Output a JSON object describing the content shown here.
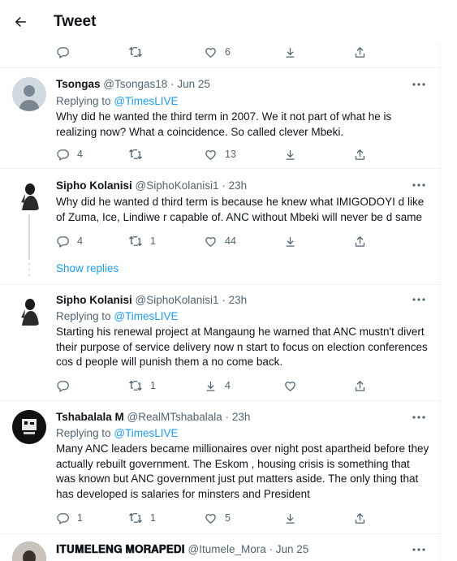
{
  "header": {
    "title": "Tweet"
  },
  "top_actions": {
    "likes": "6"
  },
  "tweets": [
    {
      "name": "Tsongas",
      "handle": "@Tsongas18",
      "sep": "·",
      "time": "Jun 25",
      "replying_prefix": "Replying to",
      "replying_to": "@TimesLIVE",
      "text": "Why did he wanted the third term in 2007. We it not part of what he is realizing now? What a coincidence. So called clever Mbeki.",
      "replies": "4",
      "retweets": "",
      "likes": "13"
    },
    {
      "name": "Sipho Kolanisi",
      "handle": "@SiphoKolanisi1",
      "sep": "·",
      "time": "23h",
      "text": "Why did he wanted d third term is because he knew what IMIGODOYI d like of Zuma, Ice, Lindiwe r capable of. ANC without Mbeki will never be d same",
      "replies": "4",
      "retweets": "1",
      "likes": "44"
    },
    {
      "name": "Sipho Kolanisi",
      "handle": "@SiphoKolanisi1",
      "sep": "·",
      "time": "23h",
      "replying_prefix": "Replying to",
      "replying_to": "@TimesLIVE",
      "text": "Starting his renewal project at Mangaung he warned that ANC mustn't divert their purpose of service delivery now n start to focus on election conferences cos d people will punish them a no come back.",
      "replies": "",
      "retweets": "1",
      "likes": "4"
    },
    {
      "name": "Tshabalala M",
      "handle": "@RealMTshabalala",
      "sep": "·",
      "time": "23h",
      "replying_prefix": "Replying to",
      "replying_to": "@TimesLIVE",
      "text": "Many ANC leaders became millionaires over night post apartheid before they actually rebuilt government. The Eskom , housing crisis is something that was known but ANC government just put matters aside. The only thing that has developed is salaries for minsters and President",
      "replies": "1",
      "retweets": "1",
      "likes": "5"
    },
    {
      "name": "𝐈𝐓𝐔𝐌𝐄𝐋𝐄𝐍𝐆 𝐌𝐎𝐑𝐀𝐏𝐄𝐃𝐈",
      "handle": "@Itumele_Mora",
      "sep": "·",
      "time": "Jun 25"
    }
  ],
  "show_replies": "Show replies",
  "icons": {
    "back": "arrow-left-icon",
    "reply": "speech-bubble-icon",
    "retweet": "retweet-icon",
    "like": "heart-icon",
    "bookmark": "bookmark-down-icon",
    "share": "share-icon",
    "more": "more-dots-icon"
  },
  "colors": {
    "accent": "#1d9bf0",
    "text": "#0f1419",
    "secondary": "#536471",
    "border": "#eff3f4"
  }
}
